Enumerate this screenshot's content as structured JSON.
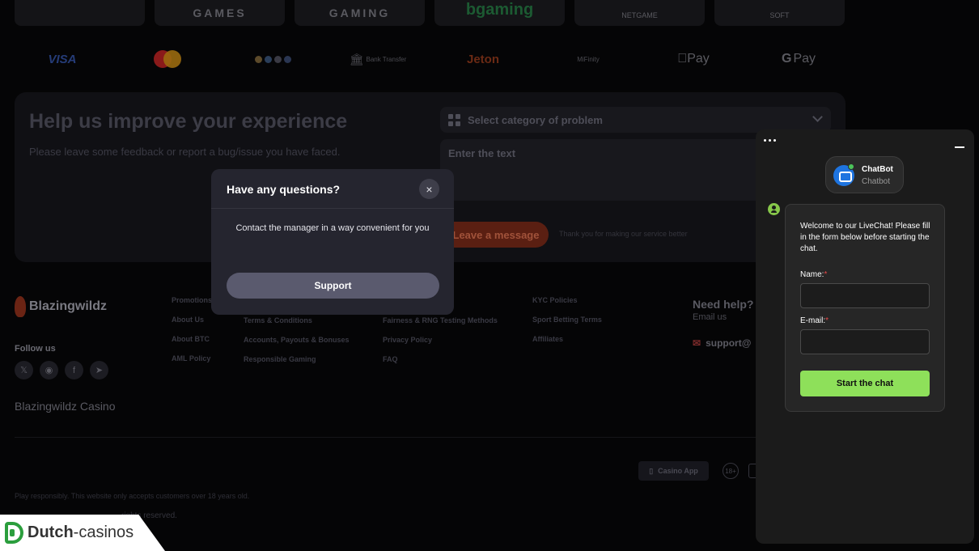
{
  "providers": [
    "",
    "GAMES",
    "GAMING",
    "bgaming",
    "NETGAME",
    "SOFT"
  ],
  "payments": [
    "VISA",
    "Bank Transfer",
    "Jeton",
    "MiFinity",
    "Pay",
    "Pay"
  ],
  "feedback": {
    "title": "Help us improve your experience",
    "subtitle": "Please leave some feedback or report a bug/issue you have faced.",
    "category_placeholder": "Select category of problem",
    "text_placeholder": "Enter the text",
    "button": "Leave a message",
    "thanks": "Thank you for making our service better"
  },
  "footer": {
    "brand": "Blazingwildz",
    "follow": "Follow us",
    "casino_name": "Blazingwildz Casino",
    "col1": [
      "Promotions",
      "About Us",
      "About BTC",
      "AML Policy"
    ],
    "col2": [
      "Terms & Conditions",
      "Accounts, Payouts & Bonuses",
      "Responsible Gaming"
    ],
    "col3": [
      "Fairness & RNG Testing Methods",
      "Privacy Policy",
      "FAQ"
    ],
    "col4": [
      "KYC Policies",
      "Sport Betting Terms",
      "Affiliates"
    ],
    "need_help": "Need help?",
    "email_us": "Email us",
    "support_email": "support@",
    "casino_app": "Casino App",
    "age": "18+",
    "responsible": "Play responsibly. This website only accepts customers over 18 years old.",
    "rights": "rights reserved."
  },
  "modal": {
    "title": "Have any questions?",
    "text": "Contact the manager in a way convenient for you",
    "button": "Support",
    "close": "×"
  },
  "chat": {
    "bot_name": "ChatBot",
    "bot_sub": "Chatbot",
    "welcome": "Welcome to our LiveChat! Please fill in the form below before starting the chat.",
    "name_label": "Name:",
    "email_label": "E-mail:",
    "required": "*",
    "start": "Start the chat"
  },
  "watermark": {
    "bold": "Dutch",
    "rest": "-casinos"
  }
}
